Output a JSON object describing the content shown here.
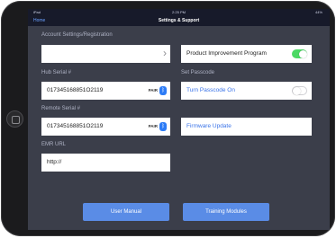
{
  "status_bar": {
    "carrier": "iPad",
    "time": "2:25 PM",
    "battery": "44%"
  },
  "nav": {
    "back_label": "Home",
    "title": "Settings & Support"
  },
  "left": {
    "account_label": "Account Settings/Registration",
    "account_value": "",
    "hub_label": "Hub Serial #",
    "hub_value": "017345168851O2119",
    "pair_label": "PAIR",
    "remote_label": "Remote Serial #",
    "remote_value": "017345168851O2119",
    "emr_label": "EMR URL",
    "emr_value": "http://"
  },
  "right": {
    "product_improvement_label": "Product Improvement Program",
    "product_improvement_on": true,
    "passcode_section_label": "Set Passcode",
    "passcode_label": "Turn Passcode On",
    "passcode_on": false,
    "firmware_label": "Firmware Update"
  },
  "buttons": {
    "user_manual": "User Manual",
    "training_modules": "Training Modules"
  },
  "icons": {
    "bluetooth": "bluetooth-icon",
    "chevron": "chevron-right-icon"
  },
  "colors": {
    "accent": "#5a8ce6",
    "toggle_on": "#4cd964",
    "link": "#3b74e8"
  }
}
